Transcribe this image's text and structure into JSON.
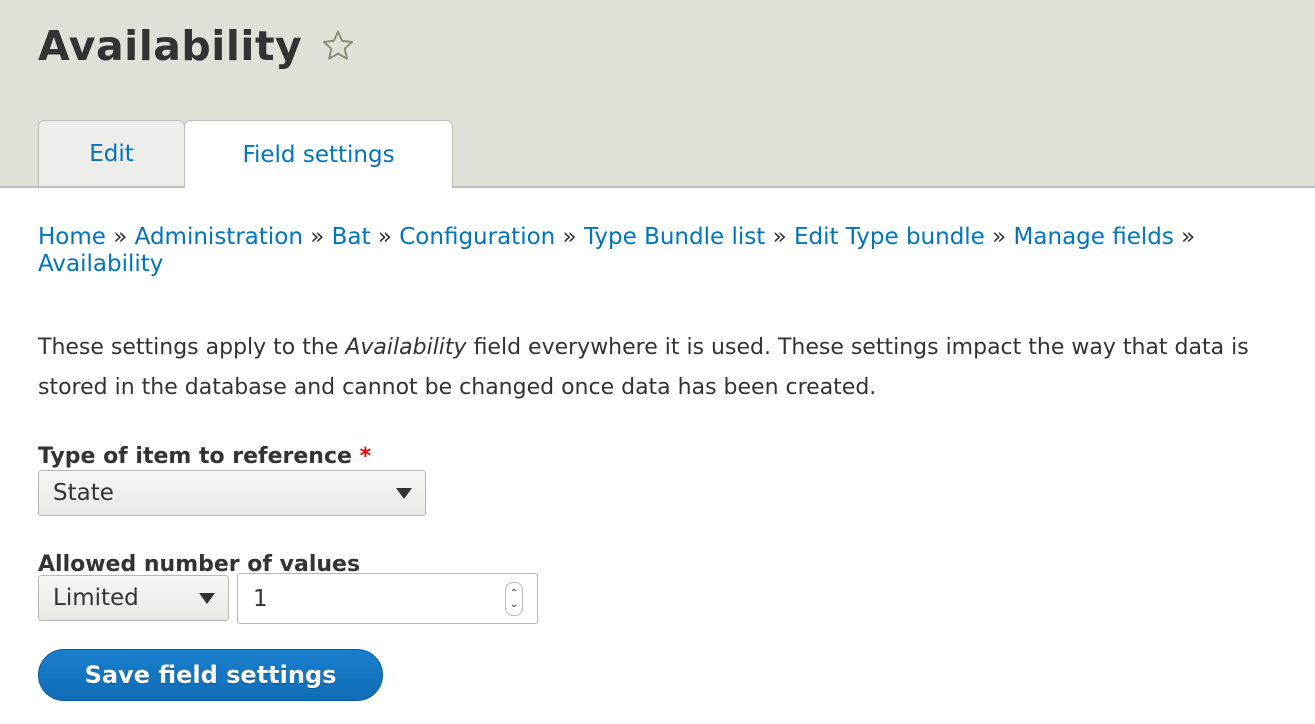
{
  "header": {
    "title": "Availability",
    "star_icon": "star-outline-icon"
  },
  "tabs": [
    {
      "label": "Edit",
      "active": false
    },
    {
      "label": "Field settings",
      "active": true
    }
  ],
  "breadcrumb": [
    "Home",
    "Administration",
    "Bat",
    "Configuration",
    "Type Bundle list",
    "Edit Type bundle",
    "Manage fields",
    "Availability"
  ],
  "breadcrumb_separator": "»",
  "description": {
    "before": "These settings apply to the ",
    "field": "Availability",
    "after": " field everywhere it is used. These settings impact the way that data is stored in the database and cannot be changed once data has been created."
  },
  "form": {
    "type_label": "Type of item to reference",
    "required_mark": "*",
    "type_value": "State",
    "allowed_label": "Allowed number of values",
    "allowed_value": "Limited",
    "count_value": "1",
    "save_label": "Save field settings"
  },
  "colors": {
    "link": "#0074bd",
    "header_bg": "#e0e0d8",
    "button": "#1a7fcb",
    "required": "#e00000"
  }
}
